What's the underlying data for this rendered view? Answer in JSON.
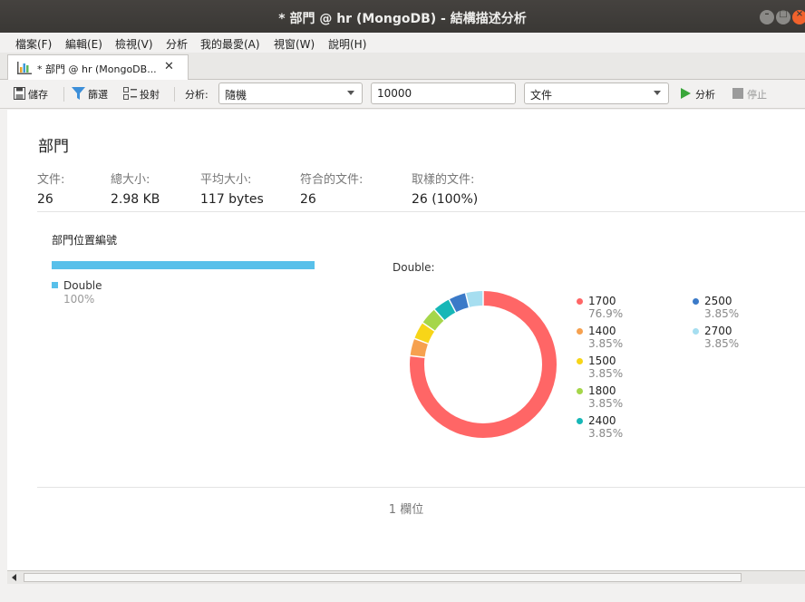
{
  "window": {
    "title": "* 部門 @ hr (MongoDB) - 結構描述分析"
  },
  "menu": [
    "檔案(F)",
    "編輯(E)",
    "檢視(V)",
    "分析",
    "我的最愛(A)",
    "視窗(W)",
    "說明(H)"
  ],
  "tab": {
    "label": "* 部門 @ hr (MongoDB...",
    "close": "✕"
  },
  "toolbar": {
    "save": "儲存",
    "filter": "篩選",
    "project": "投射",
    "analyze_label": "分析:",
    "sampling_mode": "隨機",
    "sample_size": "10000",
    "view_mode": "文件",
    "analyze_button": "分析",
    "stop_button": "停止"
  },
  "collection": {
    "name": "部門",
    "stats": [
      {
        "label": "文件:",
        "value": "26"
      },
      {
        "label": "總大小:",
        "value": "2.98 KB"
      },
      {
        "label": "平均大小:",
        "value": "117 bytes"
      },
      {
        "label": "符合的文件:",
        "value": "26"
      },
      {
        "label": "取樣的文件:",
        "value": "26 (100%)"
      }
    ]
  },
  "field": {
    "name": "部門位置編號",
    "type_name": "Double",
    "type_pct": "100%",
    "type_fraction": 1.0,
    "type_color": "#58c0ea",
    "donut_title": "Double:",
    "values": [
      {
        "label": "1700",
        "pct": "76.9%",
        "fraction": 0.769,
        "color": "#ff6666"
      },
      {
        "label": "1400",
        "pct": "3.85%",
        "fraction": 0.0385,
        "color": "#f6a14f"
      },
      {
        "label": "1500",
        "pct": "3.85%",
        "fraction": 0.0385,
        "color": "#f7d518"
      },
      {
        "label": "1800",
        "pct": "3.85%",
        "fraction": 0.0385,
        "color": "#a5d64a"
      },
      {
        "label": "2400",
        "pct": "3.85%",
        "fraction": 0.0385,
        "color": "#17b7b7"
      },
      {
        "label": "2500",
        "pct": "3.85%",
        "fraction": 0.0385,
        "color": "#3b7ac8"
      },
      {
        "label": "2700",
        "pct": "3.85%",
        "fraction": 0.0385,
        "color": "#a6def0"
      }
    ]
  },
  "footer": {
    "field_count": "1 欄位"
  }
}
